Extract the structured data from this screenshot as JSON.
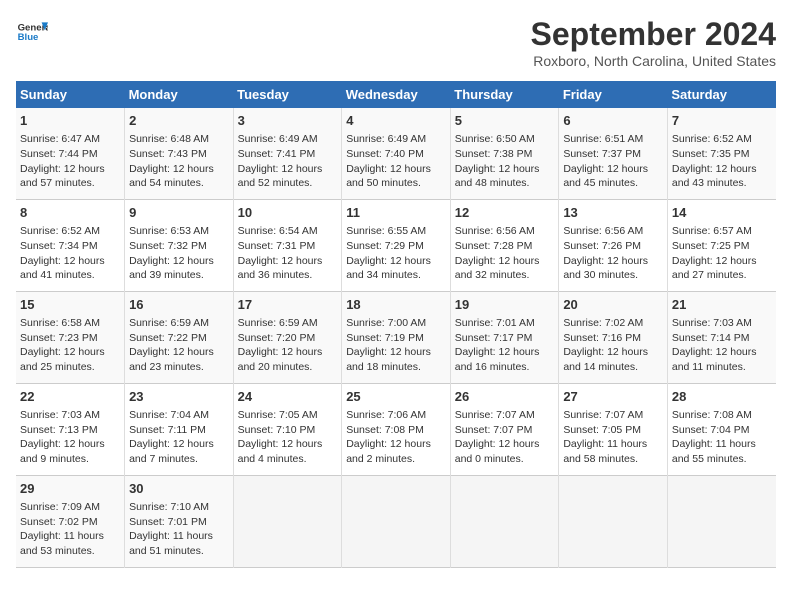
{
  "header": {
    "logo_general": "General",
    "logo_blue": "Blue",
    "month": "September 2024",
    "location": "Roxboro, North Carolina, United States"
  },
  "days_of_week": [
    "Sunday",
    "Monday",
    "Tuesday",
    "Wednesday",
    "Thursday",
    "Friday",
    "Saturday"
  ],
  "weeks": [
    [
      {
        "day": 1,
        "sunrise": "6:47 AM",
        "sunset": "7:44 PM",
        "daylight": "12 hours and 57 minutes."
      },
      {
        "day": 2,
        "sunrise": "6:48 AM",
        "sunset": "7:43 PM",
        "daylight": "12 hours and 54 minutes."
      },
      {
        "day": 3,
        "sunrise": "6:49 AM",
        "sunset": "7:41 PM",
        "daylight": "12 hours and 52 minutes."
      },
      {
        "day": 4,
        "sunrise": "6:49 AM",
        "sunset": "7:40 PM",
        "daylight": "12 hours and 50 minutes."
      },
      {
        "day": 5,
        "sunrise": "6:50 AM",
        "sunset": "7:38 PM",
        "daylight": "12 hours and 48 minutes."
      },
      {
        "day": 6,
        "sunrise": "6:51 AM",
        "sunset": "7:37 PM",
        "daylight": "12 hours and 45 minutes."
      },
      {
        "day": 7,
        "sunrise": "6:52 AM",
        "sunset": "7:35 PM",
        "daylight": "12 hours and 43 minutes."
      }
    ],
    [
      {
        "day": 8,
        "sunrise": "6:52 AM",
        "sunset": "7:34 PM",
        "daylight": "12 hours and 41 minutes."
      },
      {
        "day": 9,
        "sunrise": "6:53 AM",
        "sunset": "7:32 PM",
        "daylight": "12 hours and 39 minutes."
      },
      {
        "day": 10,
        "sunrise": "6:54 AM",
        "sunset": "7:31 PM",
        "daylight": "12 hours and 36 minutes."
      },
      {
        "day": 11,
        "sunrise": "6:55 AM",
        "sunset": "7:29 PM",
        "daylight": "12 hours and 34 minutes."
      },
      {
        "day": 12,
        "sunrise": "6:56 AM",
        "sunset": "7:28 PM",
        "daylight": "12 hours and 32 minutes."
      },
      {
        "day": 13,
        "sunrise": "6:56 AM",
        "sunset": "7:26 PM",
        "daylight": "12 hours and 30 minutes."
      },
      {
        "day": 14,
        "sunrise": "6:57 AM",
        "sunset": "7:25 PM",
        "daylight": "12 hours and 27 minutes."
      }
    ],
    [
      {
        "day": 15,
        "sunrise": "6:58 AM",
        "sunset": "7:23 PM",
        "daylight": "12 hours and 25 minutes."
      },
      {
        "day": 16,
        "sunrise": "6:59 AM",
        "sunset": "7:22 PM",
        "daylight": "12 hours and 23 minutes."
      },
      {
        "day": 17,
        "sunrise": "6:59 AM",
        "sunset": "7:20 PM",
        "daylight": "12 hours and 20 minutes."
      },
      {
        "day": 18,
        "sunrise": "7:00 AM",
        "sunset": "7:19 PM",
        "daylight": "12 hours and 18 minutes."
      },
      {
        "day": 19,
        "sunrise": "7:01 AM",
        "sunset": "7:17 PM",
        "daylight": "12 hours and 16 minutes."
      },
      {
        "day": 20,
        "sunrise": "7:02 AM",
        "sunset": "7:16 PM",
        "daylight": "12 hours and 14 minutes."
      },
      {
        "day": 21,
        "sunrise": "7:03 AM",
        "sunset": "7:14 PM",
        "daylight": "12 hours and 11 minutes."
      }
    ],
    [
      {
        "day": 22,
        "sunrise": "7:03 AM",
        "sunset": "7:13 PM",
        "daylight": "12 hours and 9 minutes."
      },
      {
        "day": 23,
        "sunrise": "7:04 AM",
        "sunset": "7:11 PM",
        "daylight": "12 hours and 7 minutes."
      },
      {
        "day": 24,
        "sunrise": "7:05 AM",
        "sunset": "7:10 PM",
        "daylight": "12 hours and 4 minutes."
      },
      {
        "day": 25,
        "sunrise": "7:06 AM",
        "sunset": "7:08 PM",
        "daylight": "12 hours and 2 minutes."
      },
      {
        "day": 26,
        "sunrise": "7:07 AM",
        "sunset": "7:07 PM",
        "daylight": "12 hours and 0 minutes."
      },
      {
        "day": 27,
        "sunrise": "7:07 AM",
        "sunset": "7:05 PM",
        "daylight": "11 hours and 58 minutes."
      },
      {
        "day": 28,
        "sunrise": "7:08 AM",
        "sunset": "7:04 PM",
        "daylight": "11 hours and 55 minutes."
      }
    ],
    [
      {
        "day": 29,
        "sunrise": "7:09 AM",
        "sunset": "7:02 PM",
        "daylight": "11 hours and 53 minutes."
      },
      {
        "day": 30,
        "sunrise": "7:10 AM",
        "sunset": "7:01 PM",
        "daylight": "11 hours and 51 minutes."
      },
      null,
      null,
      null,
      null,
      null
    ]
  ]
}
